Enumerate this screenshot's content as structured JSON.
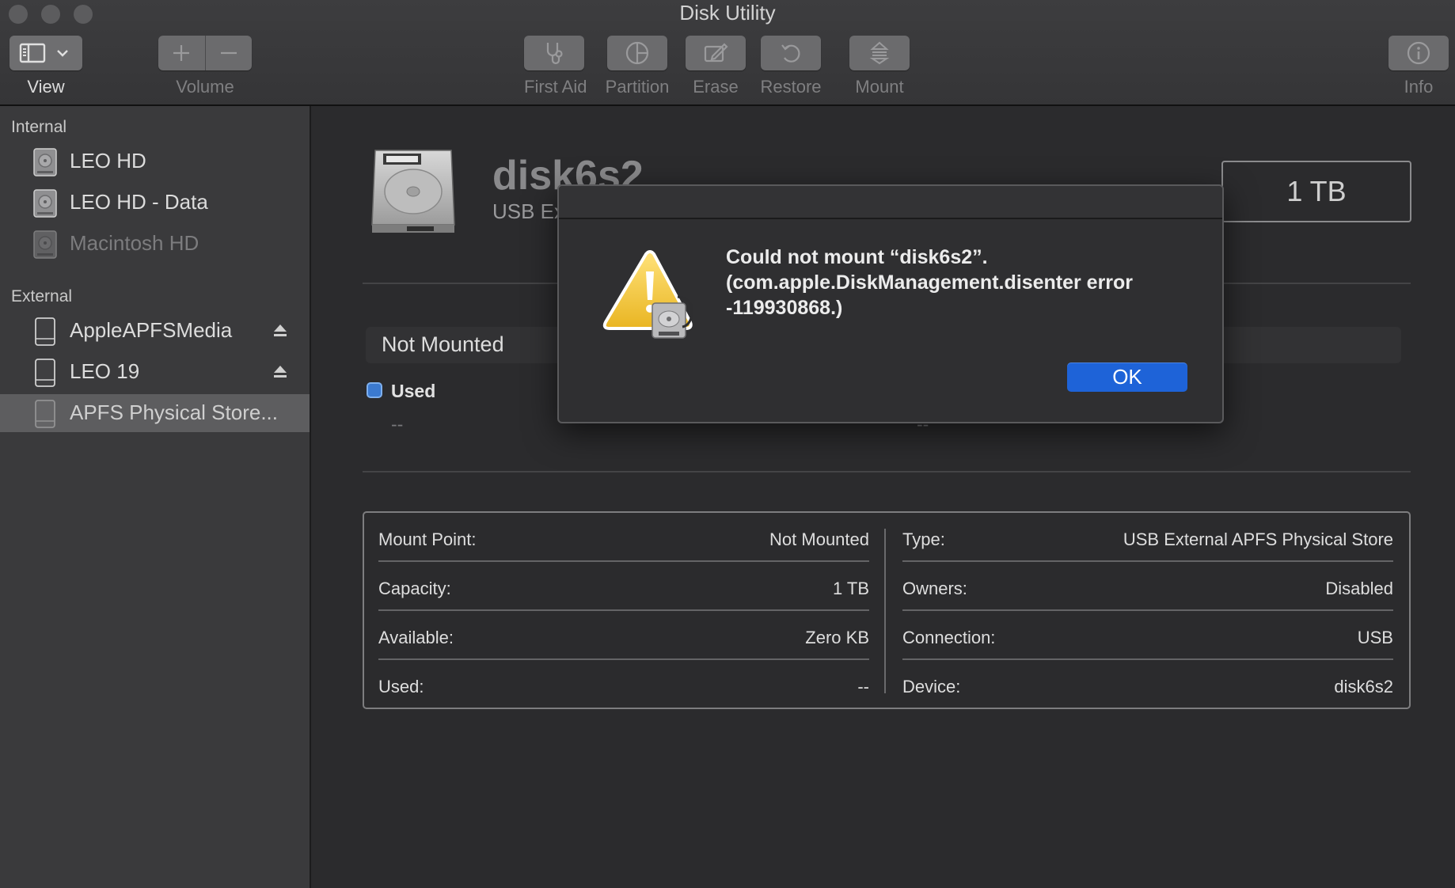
{
  "window": {
    "title": "Disk Utility"
  },
  "toolbar": {
    "view_label": "View",
    "volume_label": "Volume",
    "first_aid_label": "First Aid",
    "partition_label": "Partition",
    "erase_label": "Erase",
    "restore_label": "Restore",
    "mount_label": "Mount",
    "info_label": "Info"
  },
  "sidebar": {
    "internal_header": "Internal",
    "external_header": "External",
    "internal_items": [
      {
        "label": "LEO HD",
        "icon": "internal-disk-icon"
      },
      {
        "label": "LEO HD - Data",
        "icon": "internal-disk-icon"
      },
      {
        "label": "Macintosh HD",
        "icon": "internal-disk-icon"
      }
    ],
    "external_items": [
      {
        "label": "AppleAPFSMedia",
        "icon": "external-disk-icon"
      },
      {
        "label": "LEO 19",
        "icon": "external-disk-icon"
      },
      {
        "label": "APFS Physical Store...",
        "icon": "external-disk-icon"
      }
    ]
  },
  "main": {
    "disk_name": "disk6s2",
    "disk_subtitle": "USB Ex",
    "size": "1 TB",
    "status": "Not Mounted",
    "used_label": "Used",
    "used_value": "--",
    "used_value_2": "--",
    "colors": {
      "used": "#3b7ad0"
    },
    "info": {
      "left": [
        {
          "key": "Mount Point:",
          "value": "Not Mounted"
        },
        {
          "key": "Capacity:",
          "value": "1 TB"
        },
        {
          "key": "Available:",
          "value": "Zero KB"
        },
        {
          "key": "Used:",
          "value": "--"
        }
      ],
      "right": [
        {
          "key": "Type:",
          "value": "USB External APFS Physical Store"
        },
        {
          "key": "Owners:",
          "value": "Disabled"
        },
        {
          "key": "Connection:",
          "value": "USB"
        },
        {
          "key": "Device:",
          "value": "disk6s2"
        }
      ]
    }
  },
  "alert": {
    "line1": "Could not mount “disk6s2”.",
    "line2": "(com.apple.DiskManagement.disenter error",
    "line3": "-119930868.)",
    "ok_label": "OK",
    "icon": "warning-icon",
    "accent": "#1e63d8"
  }
}
